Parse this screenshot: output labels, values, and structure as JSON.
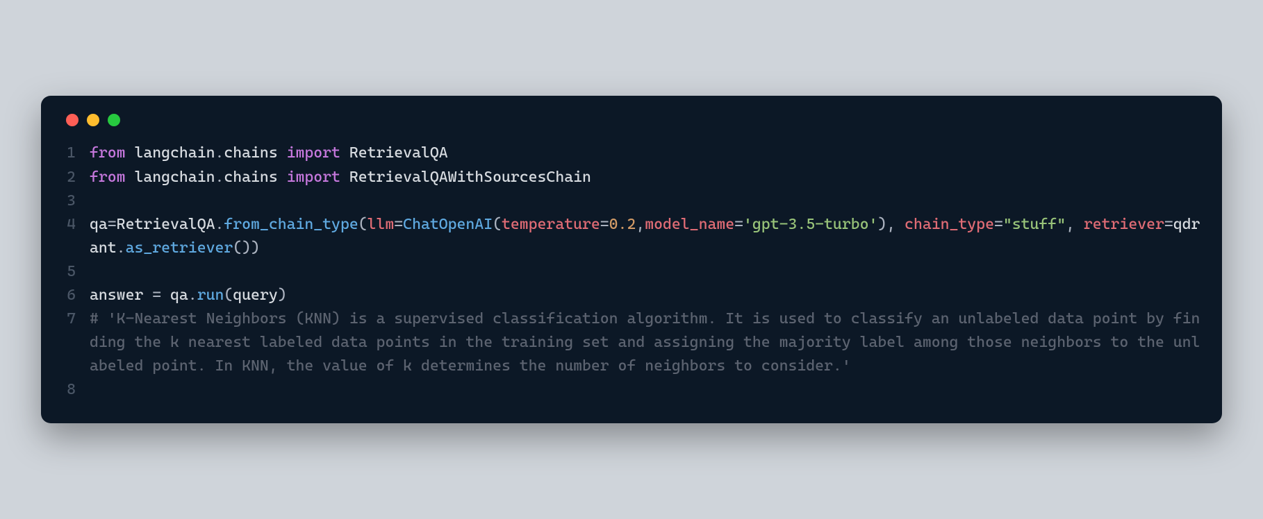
{
  "line_numbers": [
    "1",
    "2",
    "3",
    "4",
    "5",
    "6",
    "7",
    "8"
  ],
  "t": {
    "from1": "from",
    "mod1": " langchain",
    "dot": ".",
    "chains1": "chains ",
    "import1": "import",
    "retqa": " RetrievalQA",
    "from2": "from",
    "mod2": " langchain",
    "chains2": "chains ",
    "import2": "import",
    "retqasrc": " RetrievalQAWithSourcesChain",
    "qa_assign_l": "qa",
    "eq1": "=",
    "retqa_cls": "RetrievalQA",
    "fct": "from_chain_type",
    "op_paren": "(",
    "llm_kw": "llm",
    "eq2": "=",
    "chatopenai": "ChatOpenAI",
    "op_paren2": "(",
    "temp_kw": "temperature",
    "eq3": "=",
    "num02": "0.2",
    "comma1": ",",
    "modelname_kw": "model_name",
    "eq4": "=",
    "str_gpt": "'gpt-3.5-turbo'",
    "cp1": "),",
    "sp1": " ",
    "chain_type_kw": "chain_type",
    "eq5": "=",
    "str_stuff": "\"stuff\"",
    "comma2": ", ",
    "retriever_kw": "retriever",
    "eq6": "=",
    "qdrant": "qdrant",
    "as_ret": "as_retriever",
    "paren_empty": "())",
    "answer": "answer ",
    "eq7": "= ",
    "qa_var": "qa",
    "run": "run",
    "op_paren3": "(",
    "query": "query",
    "cp2": ")",
    "comment": "# 'K-Nearest Neighbors (KNN) is a supervised classification algorithm. It is used to classify an unlabeled data point by finding the k nearest labeled data points in the training set and assigning the majority label among those neighbors to the unlabeled point. In KNN, the value of k determines the number of neighbors to consider.'"
  }
}
